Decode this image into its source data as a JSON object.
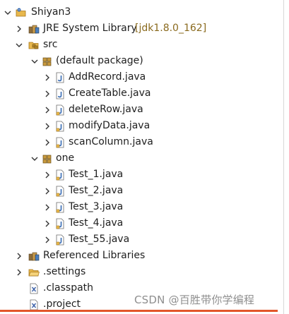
{
  "tree": {
    "project": {
      "label": "Shiyan3"
    },
    "jre": {
      "label": "JRE System Library",
      "decoration": "[jdk1.8.0_162]"
    },
    "src": {
      "label": "src"
    },
    "default_package": {
      "label": "(default package)",
      "files": [
        "AddRecord.java",
        "CreateTable.java",
        "deleteRow.java",
        "modifyData.java",
        "scanColumn.java"
      ]
    },
    "one_package": {
      "label": "one",
      "files": [
        "Test_1.java",
        "Test_2.java",
        "Test_3.java",
        "Test_4.java",
        "Test_55.java"
      ]
    },
    "referenced_libraries": {
      "label": "Referenced Libraries"
    },
    "settings": {
      "label": ".settings"
    },
    "classpath": {
      "label": ".classpath"
    },
    "project_file": {
      "label": ".project"
    }
  },
  "watermark": "CSDN @百胜带你学编程",
  "colors": {
    "accent_bar": "#e2562a",
    "decoration": "#8a6a1e",
    "package": "#b5872a",
    "folder": "#e8b84d",
    "java_file": "#2c63b0",
    "xml_file": "#3a5fa8"
  }
}
